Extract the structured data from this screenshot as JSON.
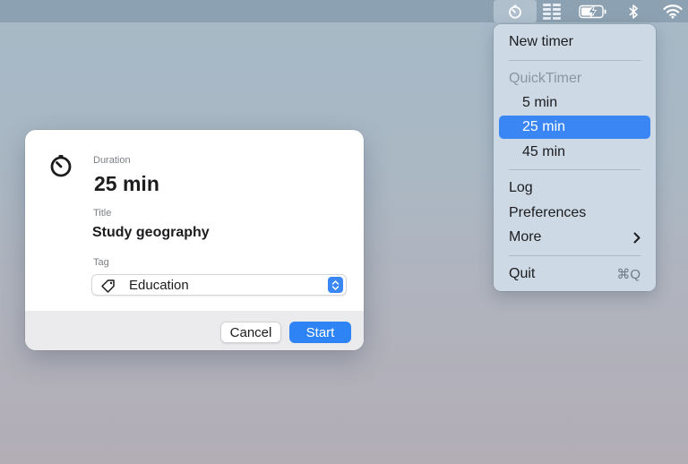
{
  "menubar": {
    "icons": [
      "timer-icon",
      "stack-icon",
      "battery-charging-icon",
      "bluetooth-icon",
      "wifi-icon"
    ]
  },
  "menu": {
    "new_timer": "New timer",
    "quicktimer_header": "QuickTimer",
    "presets": [
      "5 min",
      "25 min",
      "45 min"
    ],
    "selected_preset": "25 min",
    "log": "Log",
    "preferences": "Preferences",
    "more": "More",
    "quit": "Quit",
    "quit_shortcut": "⌘Q"
  },
  "dialog": {
    "duration_label": "Duration",
    "duration_value": "25 min",
    "title_label": "Title",
    "title_value": "Study geography",
    "tag_label": "Tag",
    "tag_value": "Education",
    "cancel_label": "Cancel",
    "start_label": "Start"
  },
  "colors": {
    "accent": "#3a86f4",
    "menu_bg": "#cedbe6",
    "dialog_footer": "#ebebed"
  }
}
